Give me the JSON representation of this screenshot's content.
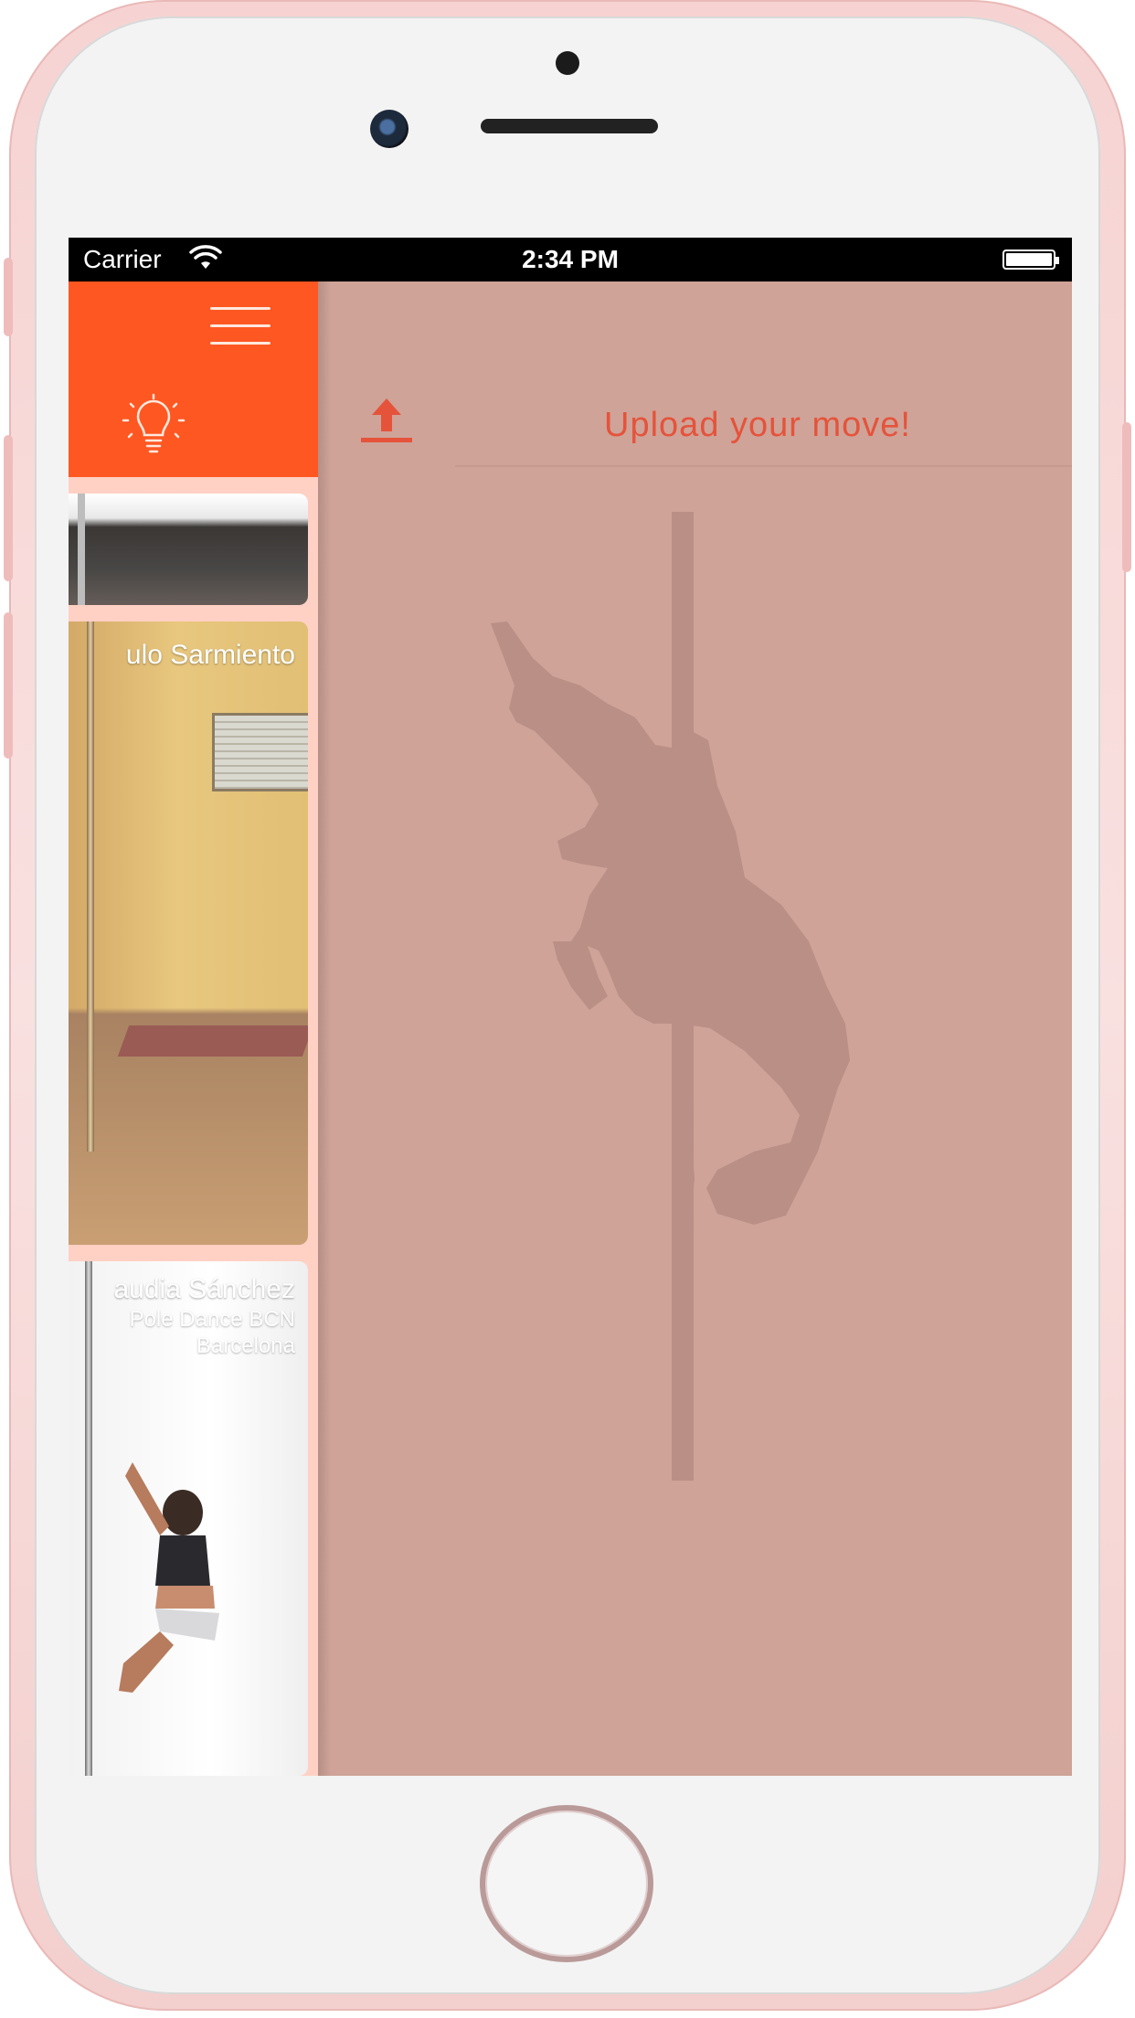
{
  "statusbar": {
    "carrier": "Carrier",
    "time": "2:34 PM"
  },
  "sidebar": {
    "menu_icon": "hamburger-icon",
    "tip_icon": "lightbulb-icon",
    "cards": [
      {
        "name": "",
        "subtitle": "",
        "location": ""
      },
      {
        "name": "ulo Sarmiento",
        "subtitle": "",
        "location": ""
      },
      {
        "name": "audia Sánchez",
        "subtitle": "Pole Dance BCN",
        "location": "Barcelona"
      }
    ]
  },
  "main": {
    "upload_icon": "upload-icon",
    "upload_label": "Upload your move!",
    "illustration": "pole-dancer-silhouette"
  },
  "colors": {
    "accent": "#ff5722",
    "upload_text": "#e5533b",
    "background": "#cfa398",
    "sidebar_bg": "#ffd0c4"
  }
}
